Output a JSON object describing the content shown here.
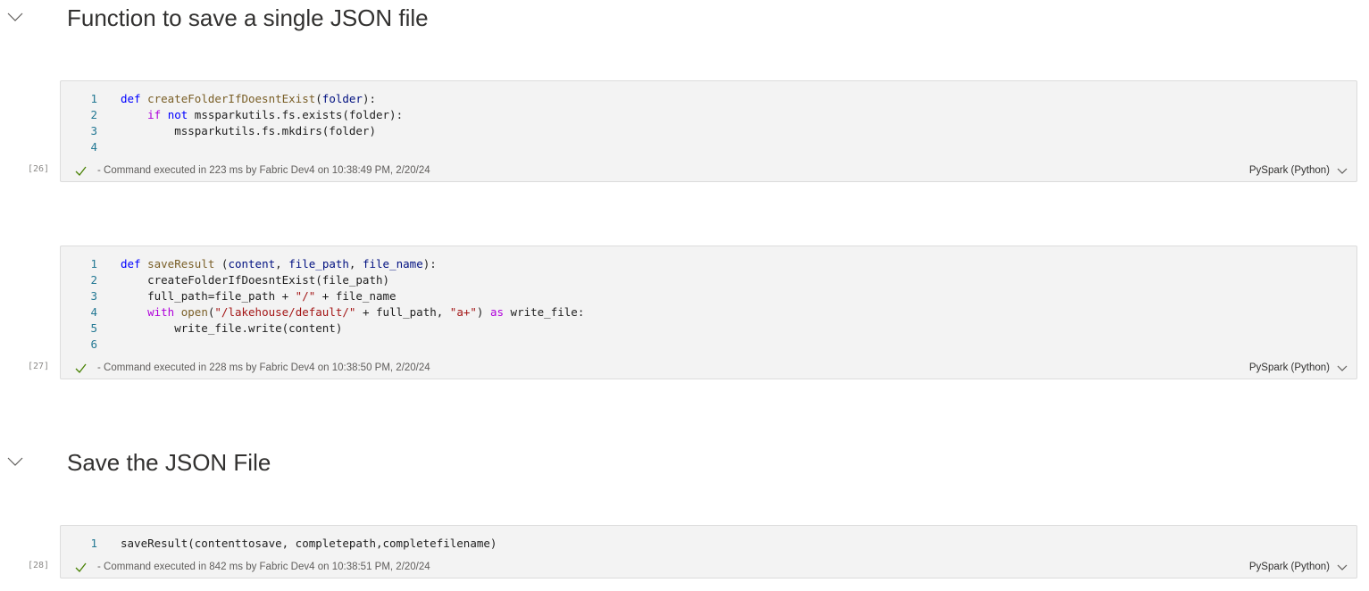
{
  "sections": [
    {
      "title": "Function to save a single JSON file"
    },
    {
      "title": "Save the JSON File"
    }
  ],
  "cells": [
    {
      "exec_count": "[26]",
      "line_numbers": [
        "1",
        "2",
        "3",
        "4"
      ],
      "code_lines": [
        "def createFolderIfDoesntExist(folder):",
        "    if not mssparkutils.fs.exists(folder):",
        "        mssparkutils.fs.mkdirs(folder)",
        ""
      ],
      "status": "- Command executed in 223 ms by Fabric Dev4 on 10:38:49 PM, 2/20/24",
      "language": "PySpark (Python)"
    },
    {
      "exec_count": "[27]",
      "line_numbers": [
        "1",
        "2",
        "3",
        "4",
        "5",
        "6"
      ],
      "code_lines": [
        "def saveResult (content, file_path, file_name):",
        "    createFolderIfDoesntExist(file_path)",
        "    full_path=file_path + \"/\" + file_name",
        "    with open(\"/lakehouse/default/\" + full_path, \"a+\") as write_file:",
        "        write_file.write(content)",
        ""
      ],
      "status": "- Command executed in 228 ms by Fabric Dev4 on 10:38:50 PM, 2/20/24",
      "language": "PySpark (Python)"
    },
    {
      "exec_count": "[28]",
      "line_numbers": [
        "1"
      ],
      "code_lines": [
        "saveResult(contenttosave, completepath,completefilename)"
      ],
      "status": "- Command executed in 842 ms by Fabric Dev4 on 10:38:51 PM, 2/20/24",
      "language": "PySpark (Python)"
    }
  ],
  "icons": {
    "section_toggle": "chevron-down-icon",
    "status_check": "checkmark-icon",
    "language_dropdown": "chevron-down-icon"
  },
  "colors": {
    "cell_background": "#f3f3f3",
    "cell_border": "#dcdcdc",
    "line_number": "#237893",
    "keyword": "#0000ff",
    "control_keyword": "#af00db",
    "function_name": "#795e26",
    "parameter": "#001080",
    "string": "#a31515",
    "check": "#498205"
  }
}
